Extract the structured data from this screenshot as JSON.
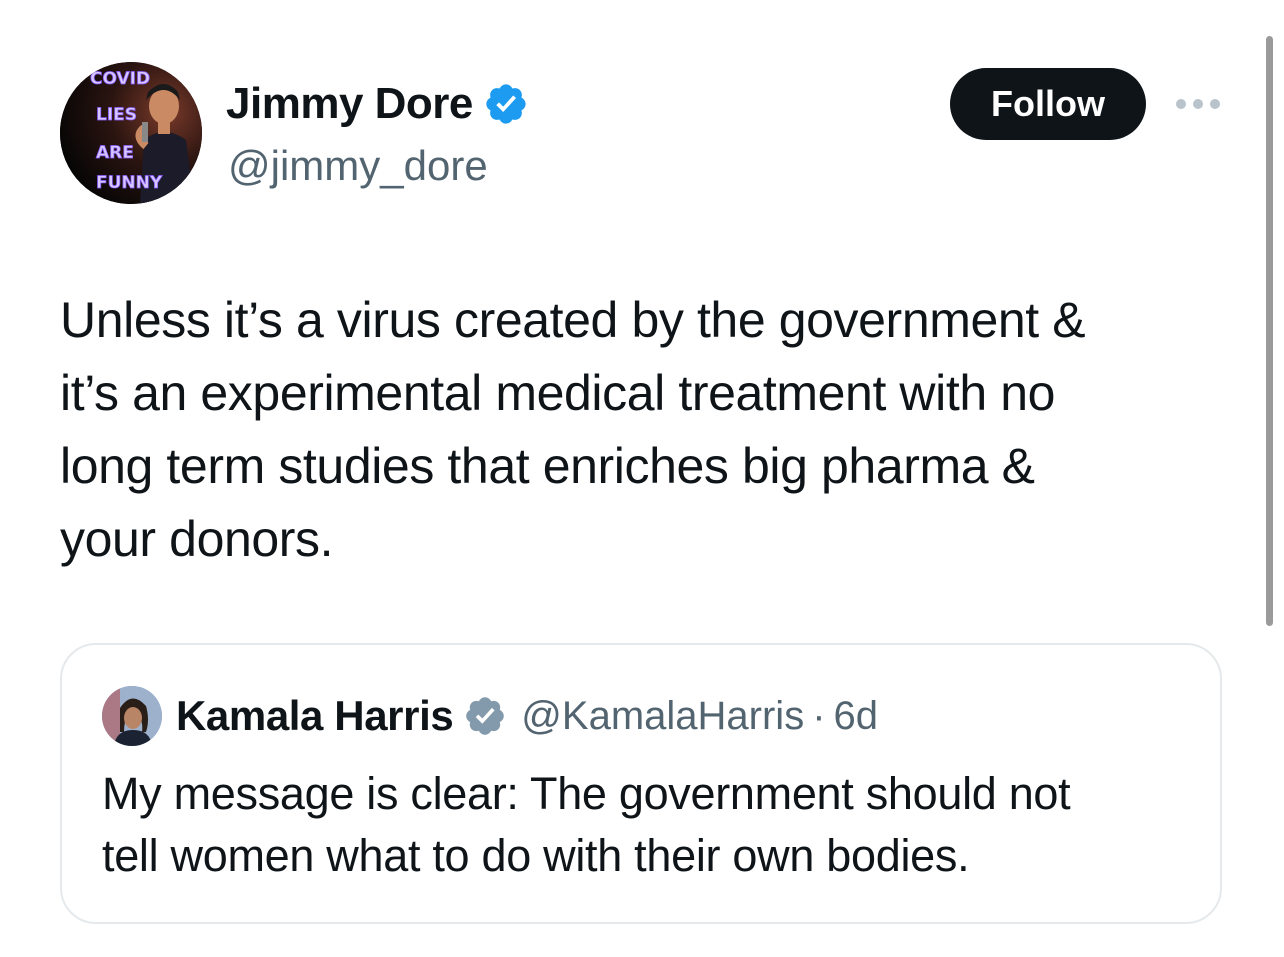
{
  "author": {
    "display_name": "Jimmy Dore",
    "handle": "@jimmy_dore",
    "avatar_text": [
      "COVID",
      "LIES",
      "ARE",
      "FUNNY"
    ]
  },
  "actions": {
    "follow_label": "Follow"
  },
  "tweet": {
    "text": "Unless it’s a virus created by the government &\nit’s an experimental medical treatment with no\nlong term studies that enriches big pharma &\nyour donors."
  },
  "quote": {
    "display_name": "Kamala Harris",
    "handle": "@KamalaHarris",
    "separator": "·",
    "time": "6d",
    "text": "My message is clear: The government should not\ntell women what to do with their own bodies."
  },
  "colors": {
    "verified_blue": "#1d9bf0",
    "verified_gray": "#829aab",
    "text_primary": "#0f1419",
    "text_secondary": "#536471",
    "follow_bg": "#0f1419"
  },
  "icons": {
    "author_badge": "verified-badge-icon",
    "quote_badge": "government-verified-badge-icon",
    "more": "more-options-icon"
  }
}
